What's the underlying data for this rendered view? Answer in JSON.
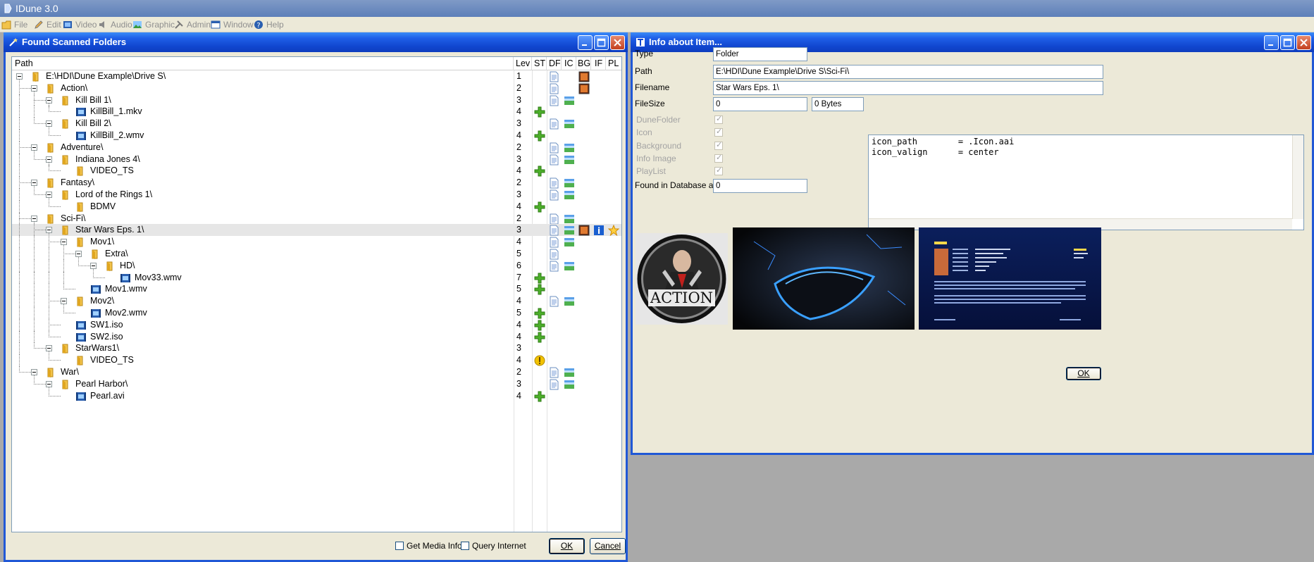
{
  "app": {
    "title": "IDune 3.0"
  },
  "menu": [
    {
      "label": "File",
      "icon": "folder-icon"
    },
    {
      "label": "Edit",
      "icon": "pencil-icon"
    },
    {
      "label": "Video",
      "icon": "film-icon"
    },
    {
      "label": "Audio",
      "icon": "speaker-icon"
    },
    {
      "label": "Graphic",
      "icon": "picture-icon"
    },
    {
      "label": "Admin",
      "icon": "tools-icon"
    },
    {
      "label": "Window",
      "icon": "window-icon"
    },
    {
      "label": "Help",
      "icon": "help-icon"
    }
  ],
  "folders_window": {
    "title": "Found Scanned Folders",
    "columns": [
      "Path",
      "Lev",
      "ST",
      "DF",
      "IC",
      "BG",
      "IF",
      "PL"
    ],
    "rows": [
      {
        "label": "E:\\HDI\\Dune Example\\Drive S\\",
        "lev": "1",
        "depth": 0,
        "kind": "folder",
        "df": true,
        "bg": true
      },
      {
        "label": "Action\\",
        "lev": "2",
        "depth": 1,
        "kind": "folder",
        "df": true,
        "bg": true
      },
      {
        "label": "Kill Bill 1\\",
        "lev": "3",
        "depth": 2,
        "kind": "folder",
        "df": true,
        "ic": true
      },
      {
        "label": "KillBill_1.mkv",
        "lev": "4",
        "depth": 3,
        "kind": "video",
        "st": "plus"
      },
      {
        "label": "Kill Bill 2\\",
        "lev": "3",
        "depth": 2,
        "kind": "folder",
        "df": true,
        "ic": true
      },
      {
        "label": "KillBill_2.wmv",
        "lev": "4",
        "depth": 3,
        "kind": "video",
        "st": "plus"
      },
      {
        "label": "Adventure\\",
        "lev": "2",
        "depth": 1,
        "kind": "folder",
        "df": true,
        "ic": true
      },
      {
        "label": "Indiana Jones 4\\",
        "lev": "3",
        "depth": 2,
        "kind": "folder",
        "df": true,
        "ic": true
      },
      {
        "label": "VIDEO_TS",
        "lev": "4",
        "depth": 3,
        "kind": "folder",
        "st": "plus"
      },
      {
        "label": "Fantasy\\",
        "lev": "2",
        "depth": 1,
        "kind": "folder",
        "df": true,
        "ic": true
      },
      {
        "label": "Lord of the Rings 1\\",
        "lev": "3",
        "depth": 2,
        "kind": "folder",
        "df": true,
        "ic": true
      },
      {
        "label": "BDMV",
        "lev": "4",
        "depth": 3,
        "kind": "folder",
        "st": "plus"
      },
      {
        "label": "Sci-Fi\\",
        "lev": "2",
        "depth": 1,
        "kind": "folder",
        "df": true,
        "ic": true
      },
      {
        "label": "Star Wars Eps. 1\\",
        "lev": "3",
        "depth": 2,
        "kind": "folder",
        "df": true,
        "ic": true,
        "bg": true,
        "if": true,
        "pl": true,
        "selected": true
      },
      {
        "label": "Mov1\\",
        "lev": "4",
        "depth": 3,
        "kind": "folder",
        "df": true,
        "ic": true
      },
      {
        "label": "Extra\\",
        "lev": "5",
        "depth": 4,
        "kind": "folder",
        "df": true
      },
      {
        "label": "HD\\",
        "lev": "6",
        "depth": 5,
        "kind": "folder",
        "df": true,
        "ic": true
      },
      {
        "label": "Mov33.wmv",
        "lev": "7",
        "depth": 6,
        "kind": "video",
        "st": "plus"
      },
      {
        "label": "Mov1.wmv",
        "lev": "5",
        "depth": 4,
        "kind": "video",
        "st": "plus"
      },
      {
        "label": "Mov2\\",
        "lev": "4",
        "depth": 3,
        "kind": "folder",
        "df": true,
        "ic": true
      },
      {
        "label": "Mov2.wmv",
        "lev": "5",
        "depth": 4,
        "kind": "video",
        "st": "plus"
      },
      {
        "label": "SW1.iso",
        "lev": "4",
        "depth": 3,
        "kind": "video",
        "st": "plus"
      },
      {
        "label": "SW2.iso",
        "lev": "4",
        "depth": 3,
        "kind": "video",
        "st": "plus"
      },
      {
        "label": "StarWars1\\",
        "lev": "3",
        "depth": 2,
        "kind": "folder"
      },
      {
        "label": "VIDEO_TS",
        "lev": "4",
        "depth": 3,
        "kind": "folder",
        "st": "warn"
      },
      {
        "label": "War\\",
        "lev": "2",
        "depth": 1,
        "kind": "folder",
        "df": true,
        "ic": true
      },
      {
        "label": "Pearl Harbor\\",
        "lev": "3",
        "depth": 2,
        "kind": "folder",
        "df": true,
        "ic": true
      },
      {
        "label": "Pearl.avi",
        "lev": "4",
        "depth": 3,
        "kind": "video",
        "st": "plus"
      }
    ],
    "get_media_info_label": "Get Media Info",
    "query_internet_label": "Query Internet",
    "ok_label": "OK",
    "cancel_label": "Cancel"
  },
  "info_window": {
    "title": "Info about Item...",
    "type_label": "Type",
    "type_value": "Folder",
    "path_label": "Path",
    "path_value": "E:\\HDI\\Dune Example\\Drive S\\Sci-Fi\\",
    "filename_label": "Filename",
    "filename_value": "Star Wars Eps. 1\\",
    "filesize_label": "FileSize",
    "filesize_value": "0",
    "filesize_bytes": "0 Bytes",
    "checks": [
      {
        "label": "DuneFolder",
        "checked": true
      },
      {
        "label": "Icon",
        "checked": true
      },
      {
        "label": "Background",
        "checked": true
      },
      {
        "label": "Info Image",
        "checked": true
      },
      {
        "label": "PlayList",
        "checked": true
      }
    ],
    "found_db_label": "Found in Database as",
    "found_db_value": "0",
    "code_lines": [
      "icon_path        = .Icon.aai",
      "icon_valign      = center"
    ],
    "action_text": "ACTION",
    "ok_label": "OK"
  },
  "colors": {
    "title_blue": "#1147d0",
    "plus_green": "#4caf2a",
    "warn_yellow": "#f2c200"
  }
}
